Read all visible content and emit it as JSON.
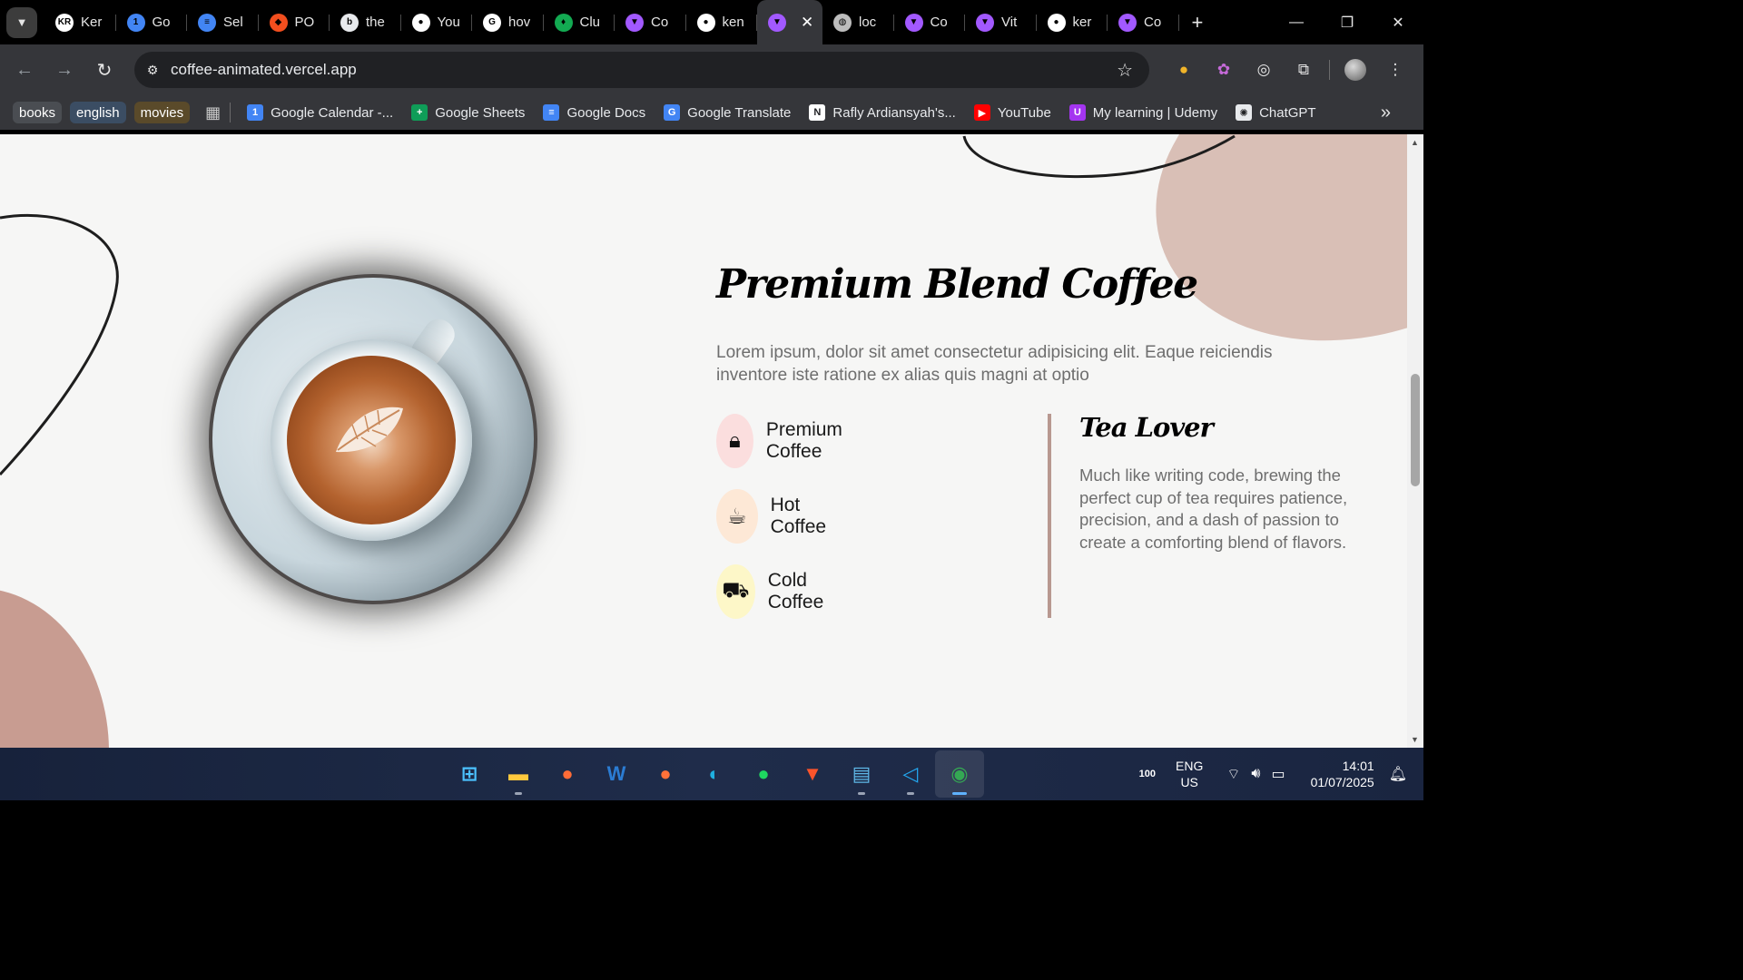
{
  "browser": {
    "tabs": [
      {
        "label": "Ker",
        "icon": "kr-avatar-icon",
        "color": "#ffffff",
        "glyph": "KR"
      },
      {
        "label": "Go",
        "icon": "google-calendar-icon",
        "color": "#4285f4",
        "glyph": "1"
      },
      {
        "label": "Sel",
        "icon": "google-docs-icon",
        "color": "#4285f4",
        "glyph": "≡"
      },
      {
        "label": "PO",
        "icon": "figma-icon",
        "color": "#f24e1e",
        "glyph": "◆"
      },
      {
        "label": "the",
        "icon": "bing-icon",
        "color": "#e8eaed",
        "glyph": "b"
      },
      {
        "label": "You",
        "icon": "github-icon",
        "color": "#ffffff",
        "glyph": "●"
      },
      {
        "label": "hov",
        "icon": "google-icon",
        "color": "#ffffff",
        "glyph": "G"
      },
      {
        "label": "Clu",
        "icon": "mongodb-leaf-icon",
        "color": "#13aa52",
        "glyph": "♦"
      },
      {
        "label": "Co",
        "icon": "vite-icon",
        "color": "#a259ff",
        "glyph": "▼"
      },
      {
        "label": "ken",
        "icon": "github-icon",
        "color": "#ffffff",
        "glyph": "●"
      },
      {
        "label": "",
        "icon": "vite-icon",
        "color": "#a259ff",
        "glyph": "▼",
        "active": true
      },
      {
        "label": "loc",
        "icon": "globe-icon",
        "color": "#bdbdbd",
        "glyph": "◍"
      },
      {
        "label": "Co",
        "icon": "vite-icon",
        "color": "#a259ff",
        "glyph": "▼"
      },
      {
        "label": "Vit",
        "icon": "vite-icon",
        "color": "#a259ff",
        "glyph": "▼"
      },
      {
        "label": "ker",
        "icon": "github-icon",
        "color": "#ffffff",
        "glyph": "●"
      },
      {
        "label": "Co",
        "icon": "vite-icon",
        "color": "#a259ff",
        "glyph": "▼"
      }
    ],
    "url": "coffee-animated.vercel.app",
    "bookmark_chips": [
      {
        "label": "books",
        "color": "#4a4d52"
      },
      {
        "label": "english",
        "color": "#3b4d63"
      },
      {
        "label": "movies",
        "color": "#5a4a2a"
      }
    ],
    "bookmarks": [
      {
        "label": "Google Calendar -...",
        "icon": "google-calendar-icon",
        "color": "#4285f4",
        "glyph": "1"
      },
      {
        "label": "Google Sheets",
        "icon": "google-sheets-icon",
        "color": "#0f9d58",
        "glyph": "+"
      },
      {
        "label": "Google Docs",
        "icon": "google-docs-icon",
        "color": "#4285f4",
        "glyph": "≡"
      },
      {
        "label": "Google Translate",
        "icon": "google-translate-icon",
        "color": "#4285f4",
        "glyph": "G"
      },
      {
        "label": "Rafly Ardiansyah's...",
        "icon": "notion-icon",
        "color": "#ffffff",
        "glyph": "N"
      },
      {
        "label": "YouTube",
        "icon": "youtube-icon",
        "color": "#ff0000",
        "glyph": "▶"
      },
      {
        "label": "My learning | Udemy",
        "icon": "udemy-icon",
        "color": "#a435f0",
        "glyph": "U"
      },
      {
        "label": "ChatGPT",
        "icon": "chatgpt-icon",
        "color": "#e8eaed",
        "glyph": "✺"
      }
    ]
  },
  "page": {
    "title": "Premium Blend Coffee",
    "lead": "Lorem ipsum, dolor sit amet consectetur adipisicing elit. Eaque reiciendis inventore iste ratione ex alias quis magni at optio",
    "features": [
      {
        "label": "Premium Coffee",
        "icon": "lock-icon",
        "glyph": "🔒︎",
        "bg": "#fbdede"
      },
      {
        "label": "Hot Coffee",
        "icon": "coffee-bag-icon",
        "glyph": "☕︎",
        "bg": "#fde8d6"
      },
      {
        "label": "Cold Coffee",
        "icon": "food-cart-icon",
        "glyph": "⛟",
        "bg": "#fdf7c8"
      }
    ],
    "side": {
      "title": "Tea Lover",
      "text": "Much like writing code, brewing the perfect cup of tea requires patience, precision, and a dash of passion to create a comforting blend of flavors."
    }
  },
  "taskbar": {
    "apps": [
      {
        "icon": "windows-start-icon",
        "glyph": "⊞",
        "color": "#4cc2ff"
      },
      {
        "icon": "file-explorer-icon",
        "glyph": "▬",
        "color": "#ffc83d",
        "running": true
      },
      {
        "icon": "postman-icon",
        "glyph": "●",
        "color": "#ff6c37"
      },
      {
        "icon": "word-icon",
        "glyph": "W",
        "color": "#2b7cd3"
      },
      {
        "icon": "firefox-icon",
        "glyph": "●",
        "color": "#ff7139"
      },
      {
        "icon": "edge-icon",
        "glyph": "◐",
        "color": "#1fb0e0"
      },
      {
        "icon": "spotify-icon",
        "glyph": "●",
        "color": "#1ed760"
      },
      {
        "icon": "brave-icon",
        "glyph": "▼",
        "color": "#fb542b"
      },
      {
        "icon": "notepad-icon",
        "glyph": "▤",
        "color": "#5fb8e8",
        "running": true
      },
      {
        "icon": "vscode-icon",
        "glyph": "◁",
        "color": "#23a9f2",
        "running": true
      },
      {
        "icon": "chrome-icon",
        "glyph": "◉",
        "color": "#34a853",
        "active": true
      }
    ],
    "tray_badge": "100",
    "lang_line1": "ENG",
    "lang_line2": "US",
    "time": "14:01",
    "date": "01/07/2025"
  }
}
